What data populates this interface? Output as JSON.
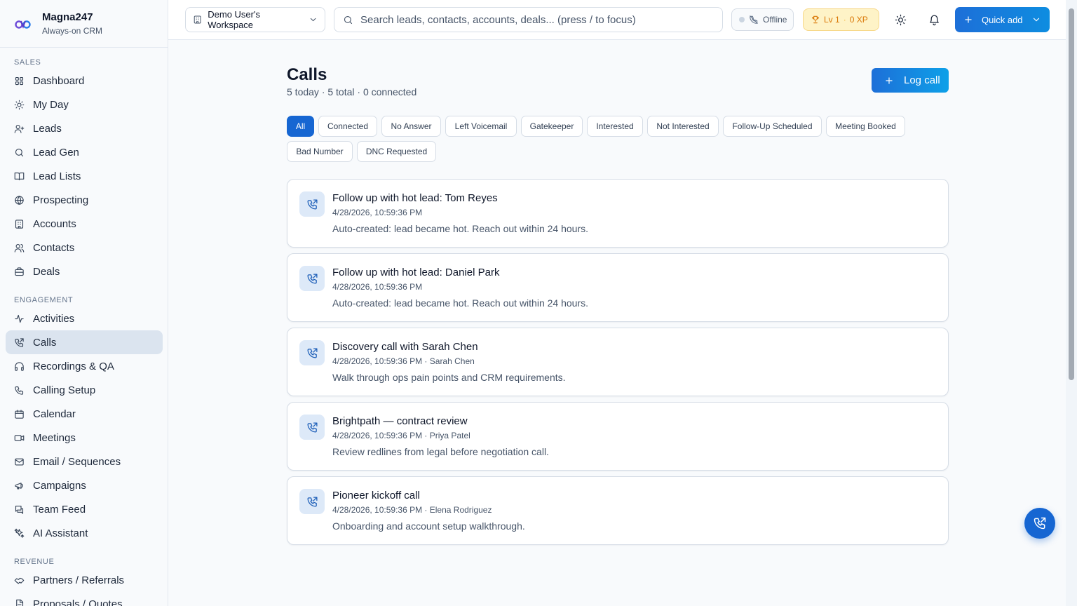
{
  "brand": {
    "name": "Magna247",
    "tagline": "Always-on CRM"
  },
  "sidebar": {
    "sections": [
      {
        "label": "SALES",
        "items": [
          {
            "label": "Dashboard",
            "icon": "dashboard-icon"
          },
          {
            "label": "My Day",
            "icon": "sun-icon"
          },
          {
            "label": "Leads",
            "icon": "user-plus-icon"
          },
          {
            "label": "Lead Gen",
            "icon": "search-icon"
          },
          {
            "label": "Lead Lists",
            "icon": "book-icon"
          },
          {
            "label": "Prospecting",
            "icon": "globe-icon"
          },
          {
            "label": "Accounts",
            "icon": "building-icon"
          },
          {
            "label": "Contacts",
            "icon": "users-icon"
          },
          {
            "label": "Deals",
            "icon": "briefcase-icon"
          }
        ]
      },
      {
        "label": "ENGAGEMENT",
        "items": [
          {
            "label": "Activities",
            "icon": "activity-icon"
          },
          {
            "label": "Calls",
            "icon": "phone-outgoing-icon",
            "active": true
          },
          {
            "label": "Recordings & QA",
            "icon": "headphones-icon"
          },
          {
            "label": "Calling Setup",
            "icon": "phone-icon"
          },
          {
            "label": "Calendar",
            "icon": "calendar-icon"
          },
          {
            "label": "Meetings",
            "icon": "video-icon"
          },
          {
            "label": "Email / Sequences",
            "icon": "mail-icon"
          },
          {
            "label": "Campaigns",
            "icon": "megaphone-icon"
          },
          {
            "label": "Team Feed",
            "icon": "chat-icon"
          },
          {
            "label": "AI Assistant",
            "icon": "sparkles-icon"
          }
        ]
      },
      {
        "label": "REVENUE",
        "items": [
          {
            "label": "Partners / Referrals",
            "icon": "handshake-icon"
          },
          {
            "label": "Proposals / Quotes",
            "icon": "file-icon"
          }
        ]
      }
    ]
  },
  "topbar": {
    "workspace": "Demo User's Workspace",
    "search_placeholder": "Search leads, contacts, accounts, deals... (press / to focus)",
    "status": "Offline",
    "level": "Lv 1",
    "xp": "0 XP",
    "quick_add": "Quick add"
  },
  "page": {
    "title": "Calls",
    "subtitle": "5 today · 5 total · 0 connected",
    "log_call": "Log call"
  },
  "filters": [
    {
      "label": "All",
      "active": true
    },
    {
      "label": "Connected"
    },
    {
      "label": "No Answer"
    },
    {
      "label": "Left Voicemail"
    },
    {
      "label": "Gatekeeper"
    },
    {
      "label": "Interested"
    },
    {
      "label": "Not Interested"
    },
    {
      "label": "Follow-Up Scheduled"
    },
    {
      "label": "Meeting Booked"
    },
    {
      "label": "Bad Number"
    },
    {
      "label": "DNC Requested"
    }
  ],
  "calls": [
    {
      "title": "Follow up with hot lead: Tom Reyes",
      "meta": "4/28/2026, 10:59:36 PM",
      "desc": "Auto-created: lead became hot. Reach out within 24 hours."
    },
    {
      "title": "Follow up with hot lead: Daniel Park",
      "meta": "4/28/2026, 10:59:36 PM",
      "desc": "Auto-created: lead became hot. Reach out within 24 hours."
    },
    {
      "title": "Discovery call with Sarah Chen",
      "meta": "4/28/2026, 10:59:36 PM · Sarah Chen",
      "desc": "Walk through ops pain points and CRM requirements."
    },
    {
      "title": "Brightpath — contract review",
      "meta": "4/28/2026, 10:59:36 PM · Priya Patel",
      "desc": "Review redlines from legal before negotiation call."
    },
    {
      "title": "Pioneer kickoff call",
      "meta": "4/28/2026, 10:59:36 PM · Elena Rodriguez",
      "desc": "Onboarding and account setup walkthrough."
    }
  ],
  "colors": {
    "accent": "#1666d2",
    "xp": "#d97706",
    "active_nav": "#dbe4ef"
  }
}
